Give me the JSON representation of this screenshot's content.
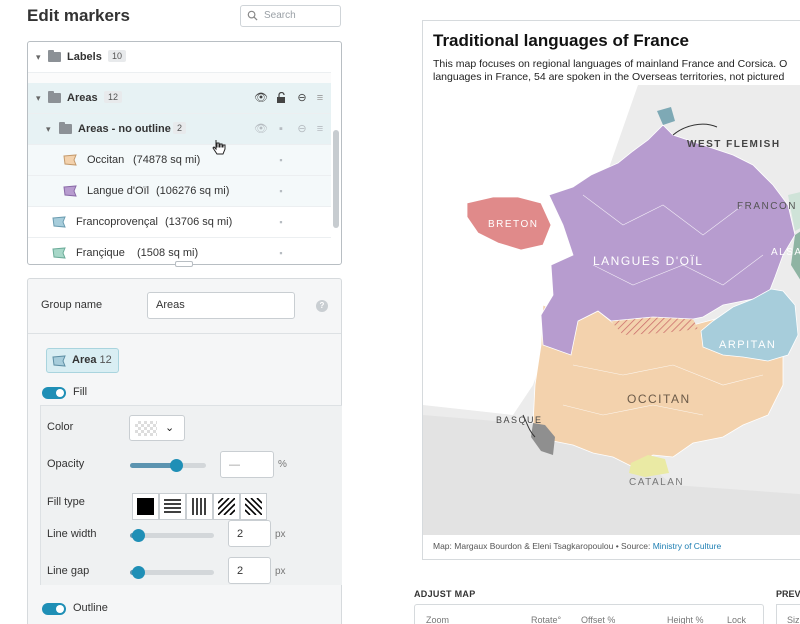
{
  "panel": {
    "title": "Edit markers",
    "search_placeholder": "Search"
  },
  "tree": {
    "rows": [
      {
        "label": "Labels",
        "count": "10"
      },
      {
        "label": "Areas",
        "count": "12"
      },
      {
        "label": "Areas - no outline",
        "count": "2"
      },
      {
        "label": "Occitan",
        "detail": "(74878 sq mi)"
      },
      {
        "label": "Langue d'Oïl",
        "detail": "(106276 sq mi)"
      },
      {
        "label": "Francoprovençal",
        "detail": "(13706 sq mi)"
      },
      {
        "label": "Françique",
        "detail": "(1508 sq mi)"
      }
    ]
  },
  "props": {
    "group_name_label": "Group name",
    "group_name_value": "Areas",
    "help": "?",
    "chip_label": "Area",
    "chip_count": "12",
    "fill_label": "Fill",
    "color_label": "Color",
    "opacity_label": "Opacity",
    "opacity_value": "—",
    "opacity_unit": "%",
    "fill_type_label": "Fill type",
    "line_width_label": "Line width",
    "line_width_value": "2",
    "line_width_unit": "px",
    "line_gap_label": "Line gap",
    "line_gap_value": "2",
    "line_gap_unit": "px",
    "outline_label": "Outline",
    "opacity_level": 0.6,
    "line_width_level": 0.1,
    "line_gap_level": 0.1
  },
  "map": {
    "title": "Traditional languages of France",
    "desc_line1": "This map focuses on regional languages of mainland France and Corsica. O",
    "desc_line2": "languages in France, 54 are spoken in the Overseas territories, not pictured",
    "labels": {
      "west_flemish": "WEST FLEMISH",
      "francique": "FRANCON",
      "breton": "BRETON",
      "alsatian": "ALSA",
      "oil": "LANGUES D'OÏL",
      "arpitan": "ARPITAN",
      "occitan": "OCCITAN",
      "basque": "BASQUE",
      "catalan": "CATALAN"
    },
    "credit_prefix": "Map: Margaux Bourdon & Eleni Tsagkaropoulou • Source: ",
    "credit_source": "Ministry of Culture",
    "colors": {
      "oil": "#b79ccf",
      "occitan": "#f3d2ad",
      "breton": "#e08a8a",
      "arpitan": "#a7cddb",
      "catalan": "#eaeaa4",
      "basque": "#8f8f8f",
      "flemish": "#7ea9b5",
      "alsatian": "#8fb4a3",
      "land": "#ececec",
      "sea": "#ffffff"
    }
  },
  "bottom": {
    "adjust_title": "ADJUST MAP",
    "preview_title": "PREV",
    "columns": [
      "Zoom",
      "Rotate°",
      "Offset %",
      "Height %",
      "Lock"
    ],
    "preview_col": "Siz"
  }
}
